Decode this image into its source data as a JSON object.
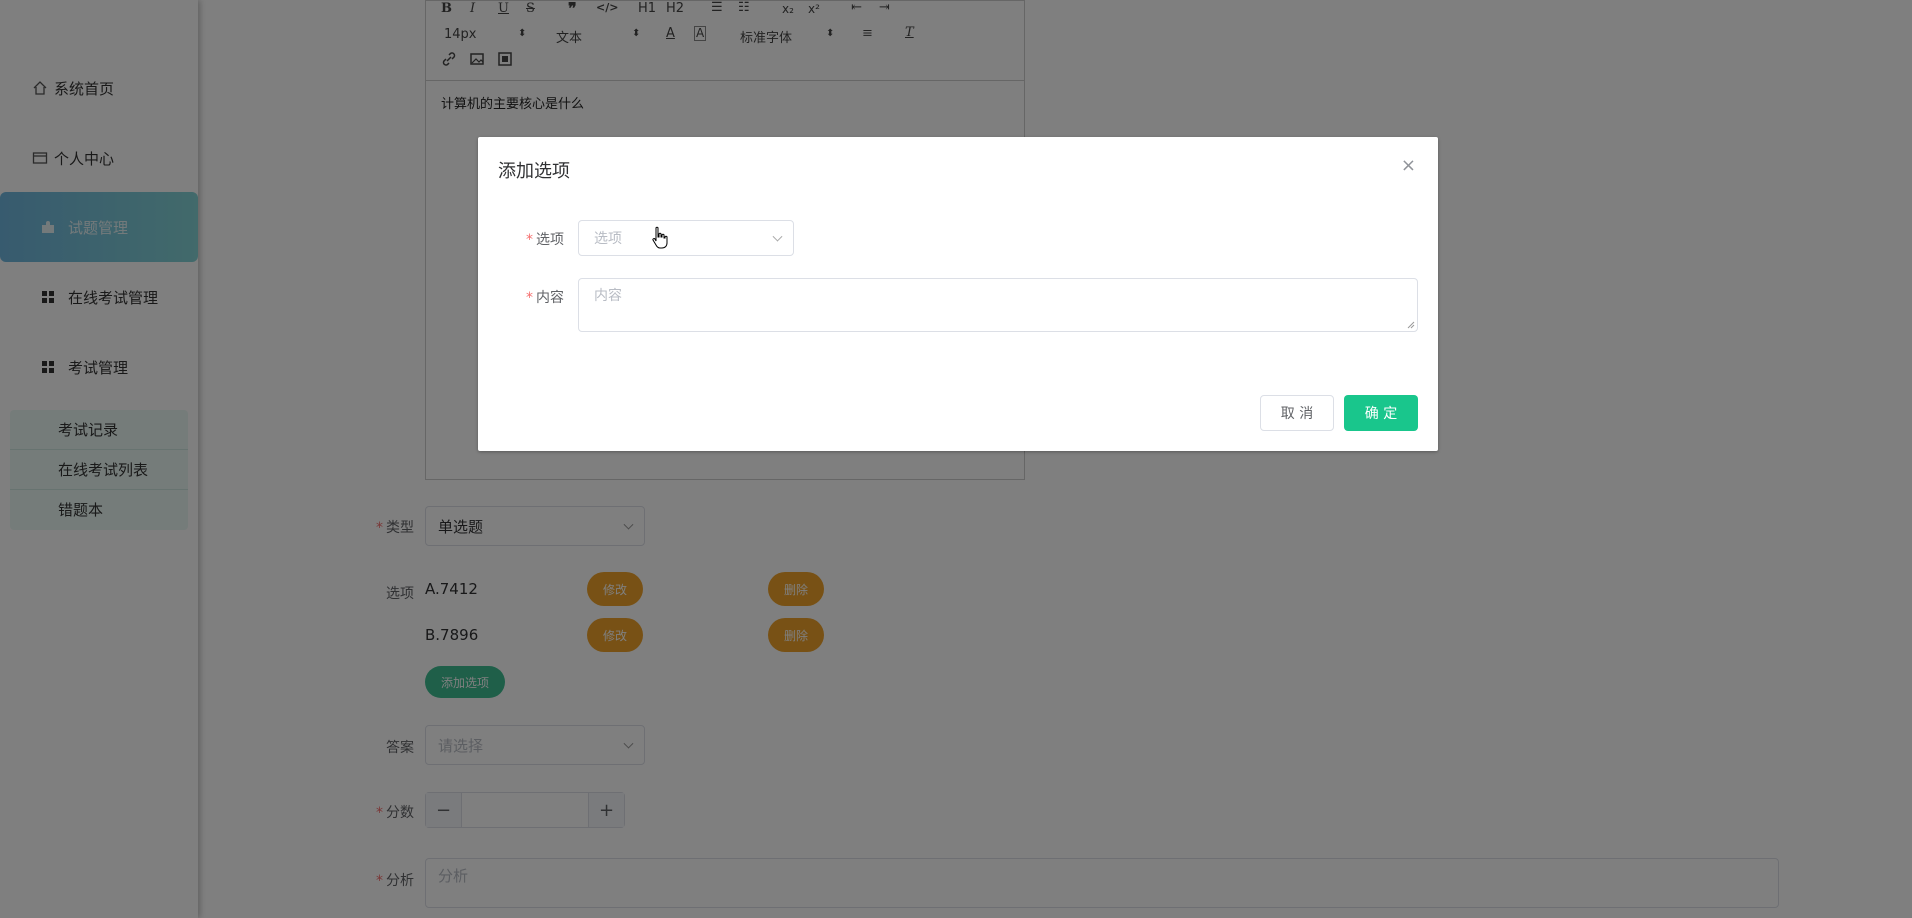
{
  "sidebar": {
    "items": [
      {
        "label": "系统首页",
        "icon": "home-icon"
      },
      {
        "label": "个人中心",
        "icon": "id-card-icon"
      },
      {
        "label": "试题管理",
        "icon": "puzzle-icon"
      },
      {
        "label": "在线考试管理",
        "icon": "grid-icon"
      },
      {
        "label": "考试管理",
        "icon": "grid-icon"
      }
    ],
    "sub_items": [
      "考试记录",
      "在线考试列表",
      "错题本"
    ]
  },
  "editor": {
    "toolbar": {
      "bold": "B",
      "italic": "I",
      "underline": "U",
      "strike": "S",
      "h1": "H1",
      "h2": "H2",
      "sub": "x₂",
      "sup": "x²",
      "font_size": "14px",
      "block_type": "文本",
      "font_family": "标准字体"
    },
    "content": "计算机的主要核心是什么"
  },
  "form": {
    "type_label": "类型",
    "type_value": "单选题",
    "options_label": "选项",
    "options": [
      {
        "text": "A.7412",
        "edit": "修改",
        "delete": "删除"
      },
      {
        "text": "B.7896",
        "edit": "修改",
        "delete": "删除"
      }
    ],
    "add_option": "添加选项",
    "answer_label": "答案",
    "answer_placeholder": "请选择",
    "score_label": "分数",
    "minus": "−",
    "plus": "+",
    "analysis_label": "分析",
    "analysis_placeholder": "分析"
  },
  "dialog": {
    "title": "添加选项",
    "close": "×",
    "option_label": "选项",
    "option_placeholder": "选项",
    "content_label": "内容",
    "content_placeholder": "内容",
    "cancel": "取 消",
    "confirm": "确 定"
  },
  "colors": {
    "accent_green": "#19c68c",
    "pill_orange": "#f0a32a",
    "sidebar_active": "#6fb6de"
  }
}
